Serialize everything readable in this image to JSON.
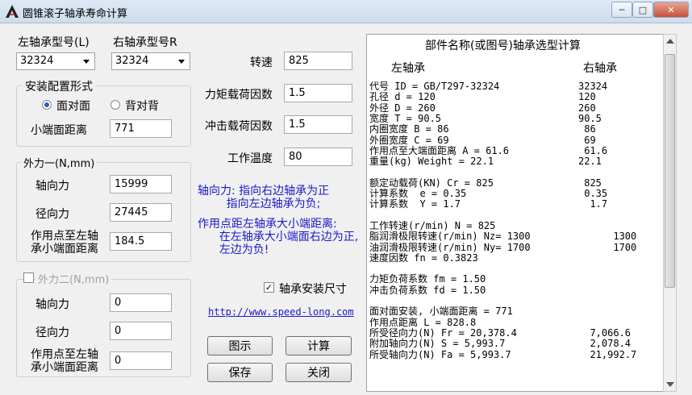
{
  "window": {
    "title": "圆锥滚子轴承寿命计算",
    "minimize": "─",
    "maximize": "□",
    "close": "✕"
  },
  "left_bearing": {
    "label": "左轴承型号(L)",
    "value": "32324"
  },
  "right_bearing": {
    "label": "右轴承型号R",
    "value": "32324"
  },
  "mounting": {
    "title": "安装配置形式",
    "face_to_face": "面对面",
    "back_to_back": "背对背",
    "small_end_distance_label": "小端面距离",
    "small_end_distance": "771"
  },
  "force1": {
    "title": "外力一(N,mm)",
    "axial_label": "轴向力",
    "axial": "15999",
    "radial_label": "径向力",
    "radial": "27445",
    "point_label_1": "作用点至左轴",
    "point_label_2": "承小端面距离",
    "point": "184.5"
  },
  "force2": {
    "title": "外力二(N,mm)",
    "axial_label": "轴向力",
    "axial": "0",
    "radial_label": "径向力",
    "radial": "0",
    "point_label_1": "作用点至左轴",
    "point_label_2": "承小端面距离",
    "point": "0"
  },
  "params": {
    "speed_label": "转速",
    "speed": "825",
    "moment_factor_label": "力矩载荷因数",
    "moment_factor": "1.5",
    "impact_factor_label": "冲击载荷因数",
    "impact_factor": "1.5",
    "temp_label": "工作温度",
    "temp": "80"
  },
  "notes": {
    "axial_note": "轴向力: 指向右边轴承为正\n        指向左边轴承为负;",
    "point_note": "作用点距左轴承大小端距离:\n      在左轴承大小端面右边为正,\n      左边为负!"
  },
  "install_size": {
    "label": "轴承安装尺寸",
    "checked": "✓"
  },
  "link": "http://www.speed-long.com",
  "buttons": {
    "diagram": "图示",
    "calculate": "计算",
    "save": "保存",
    "close": "关闭"
  },
  "report": {
    "title": "部件名称(或图号)轴承选型计算",
    "left_header": "左轴承",
    "right_header": "右轴承",
    "rows": [
      {
        "left": "代号 ID = GB/T297-32324",
        "right": "32324"
      },
      {
        "left": "孔径 d = 120",
        "right": "120"
      },
      {
        "left": "外径 D = 260",
        "right": "260"
      },
      {
        "left": "宽度 T = 90.5",
        "right": "90.5"
      },
      {
        "left": "内圈宽度 B = 86",
        "right": " 86"
      },
      {
        "left": "外圈宽度 C = 69",
        "right": " 69"
      },
      {
        "left": "作用点至大端面距离 A = 61.6",
        "right": " 61.6"
      },
      {
        "left": "重量(kg) Weight = 22.1",
        "right": "22.1"
      },
      {
        "left": "",
        "right": ""
      },
      {
        "left": "额定动载荷(KN) Cr = 825",
        "right": " 825"
      },
      {
        "left": "计算系数  e = 0.35",
        "right": " 0.35"
      },
      {
        "left": "计算系数  Y = 1.7",
        "right": "  1.7"
      },
      {
        "left": "",
        "right": ""
      },
      {
        "left": "工作转速(r/min) N = 825",
        "right": ""
      },
      {
        "left": "脂润滑极限转速(r/min) Nz= 1300",
        "right": "      1300"
      },
      {
        "left": "油润滑极限转速(r/min) Ny= 1700",
        "right": "      1700"
      },
      {
        "left": "速度因数 fn = 0.3823",
        "right": ""
      },
      {
        "left": "",
        "right": ""
      },
      {
        "left": "力矩负荷系数 fm = 1.50",
        "right": ""
      },
      {
        "left": "冲击负荷系数 fd = 1.50",
        "right": ""
      },
      {
        "left": "",
        "right": ""
      },
      {
        "left": "面对面安装, 小端面距离 = 771",
        "right": ""
      },
      {
        "left": "作用点距离 L = 828.8",
        "right": ""
      },
      {
        "left": "所受径向力(N) Fr = 20,378.4",
        "right": "  7,066.6"
      },
      {
        "left": "附加轴向力(N) S = 5,993.7",
        "right": "  2,078.4"
      },
      {
        "left": "所受轴向力(N) Fa = 5,993.7",
        "right": "  21,992.7"
      }
    ]
  }
}
